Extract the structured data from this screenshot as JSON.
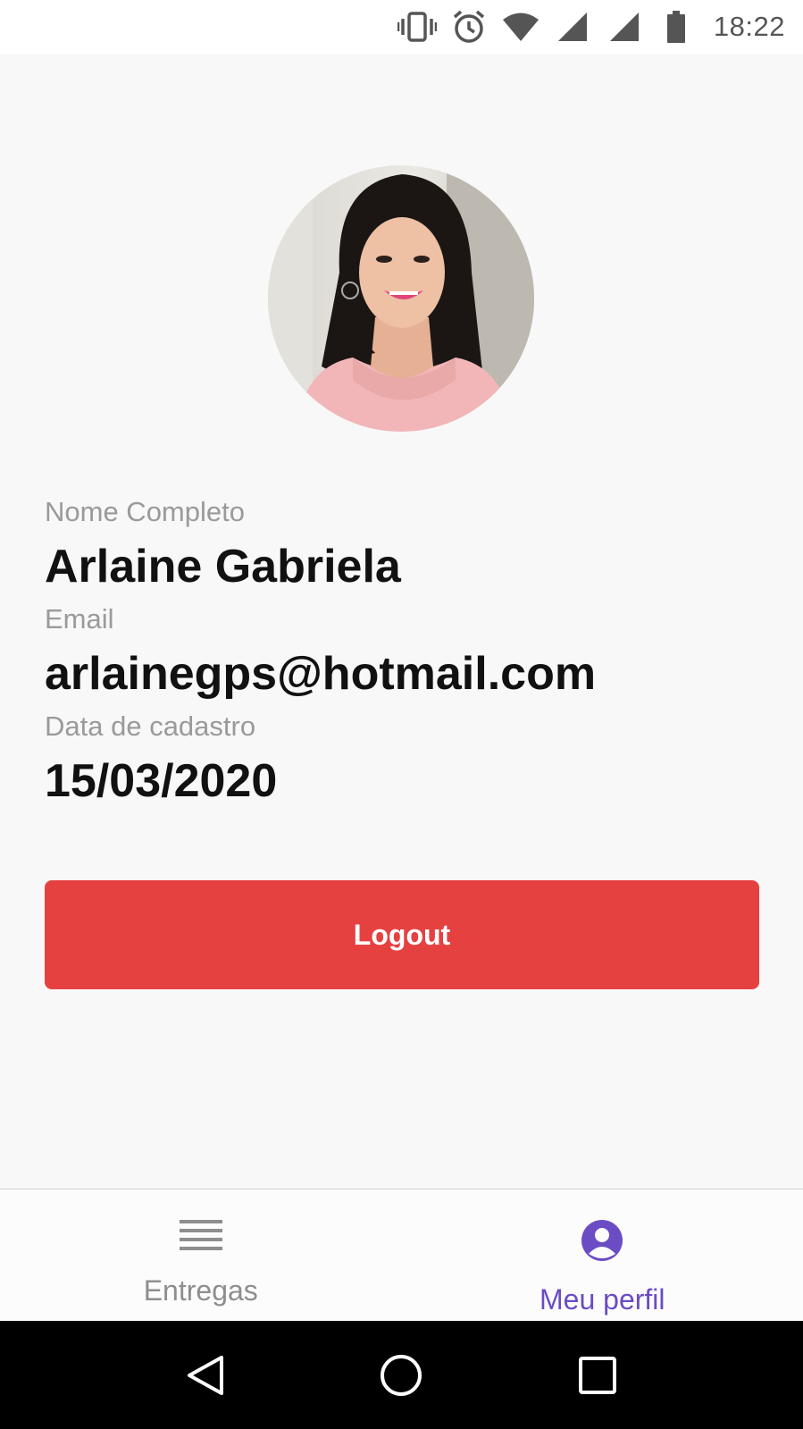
{
  "status_bar": {
    "time": "18:22",
    "icons": [
      "vibrate-icon",
      "alarm-icon",
      "wifi-icon",
      "signal-icon",
      "signal-icon",
      "battery-icon"
    ]
  },
  "profile": {
    "avatar_icon": "profile-photo",
    "fields": [
      {
        "label": "Nome Completo",
        "value": "Arlaine Gabriela"
      },
      {
        "label": "Email",
        "value": "arlainegps@hotmail.com"
      },
      {
        "label": "Data de cadastro",
        "value": "15/03/2020"
      }
    ],
    "logout_label": "Logout",
    "logout_color": "#e64141"
  },
  "bottom_nav": {
    "items": [
      {
        "label": "Entregas",
        "icon": "list-icon",
        "active": false
      },
      {
        "label": "Meu perfil",
        "icon": "user-circle-icon",
        "active": true
      }
    ],
    "active_color": "#6b4cc4",
    "inactive_color": "#8e8e8e"
  },
  "system_nav": {
    "buttons": [
      "back-icon",
      "home-icon",
      "recents-icon"
    ]
  }
}
